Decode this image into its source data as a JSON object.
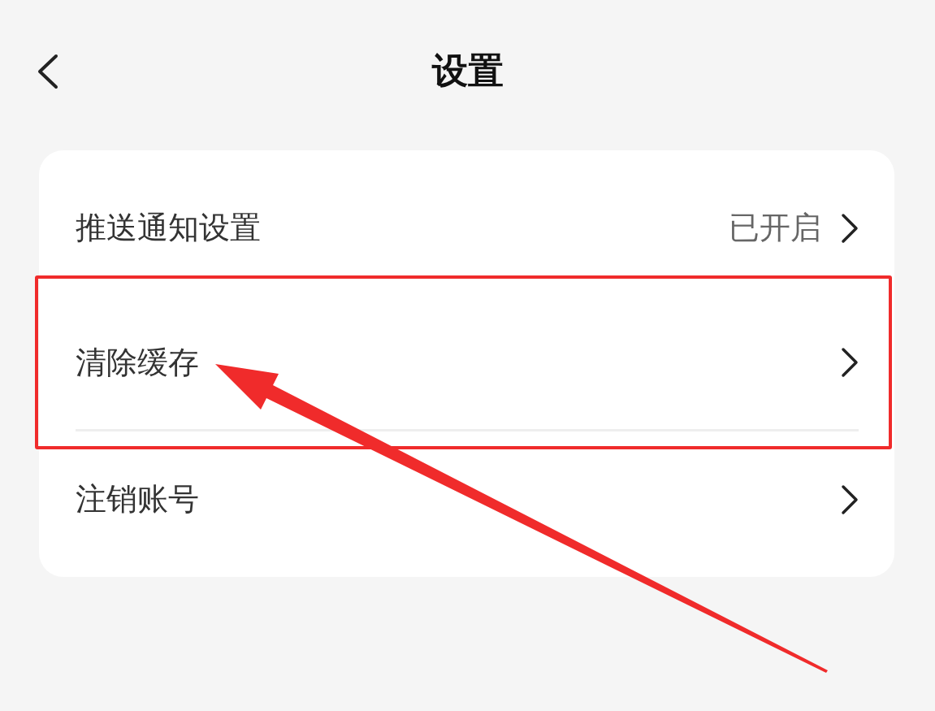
{
  "header": {
    "title": "设置"
  },
  "settings": [
    {
      "label": "推送通知设置",
      "value": "已开启",
      "divider": false
    },
    {
      "label": "清除缓存",
      "divider": true
    },
    {
      "label": "注销账号",
      "divider": false
    }
  ],
  "annotations": {
    "highlight_box": true,
    "arrow": true
  }
}
